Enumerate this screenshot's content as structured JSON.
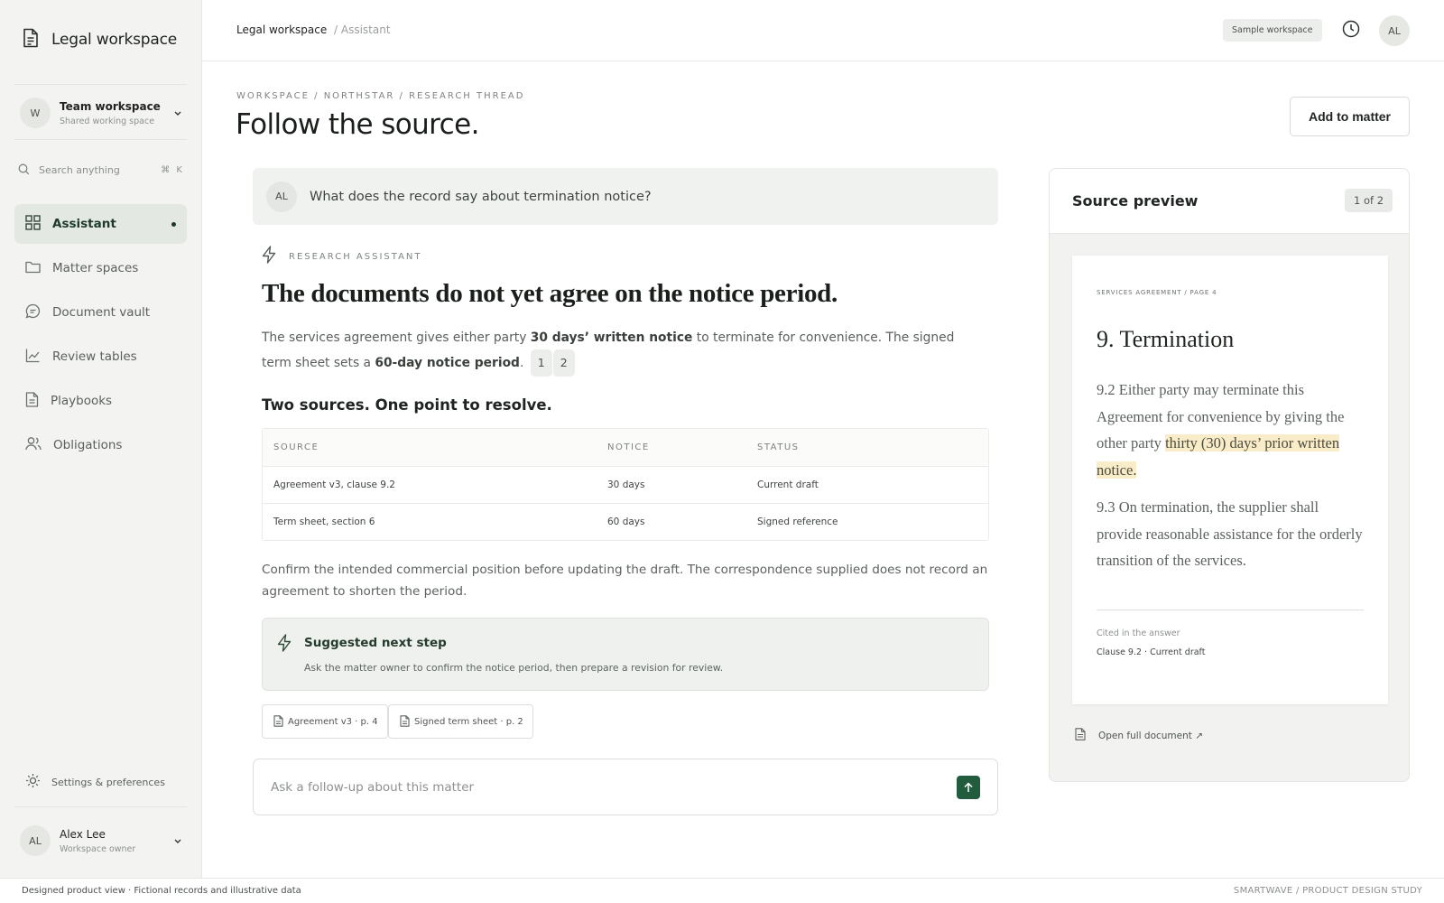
{
  "brand": {
    "name": "Legal workspace"
  },
  "workspace": {
    "initial": "W",
    "name": "Team workspace",
    "subtitle": "Shared working space"
  },
  "search": {
    "placeholder": "Search anything",
    "shortcut": "⌘ K"
  },
  "nav": {
    "items": [
      {
        "label": "Assistant",
        "icon": "grid-icon",
        "active": true
      },
      {
        "label": "Matter spaces",
        "icon": "folder-icon"
      },
      {
        "label": "Document vault",
        "icon": "chat-bubble-icon"
      },
      {
        "label": "Review tables",
        "icon": "line-chart-icon"
      },
      {
        "label": "Playbooks",
        "icon": "document-icon"
      },
      {
        "label": "Obligations",
        "icon": "users-icon"
      }
    ]
  },
  "settings": {
    "label": "Settings & preferences"
  },
  "user": {
    "initials": "AL",
    "name": "Alex Lee",
    "role": "Workspace owner"
  },
  "topbar": {
    "breadcrumb_main": "Legal workspace",
    "breadcrumb_sub": "/ Assistant",
    "badge": "Sample workspace",
    "avatar_initials": "AL"
  },
  "page": {
    "eyebrow": "WORKSPACE / NORTHSTAR / RESEARCH THREAD",
    "title": "Follow the source.",
    "add_button": "Add to matter"
  },
  "question": {
    "initials": "AL",
    "text": "What does the record say about termination notice?"
  },
  "answer": {
    "label": "RESEARCH ASSISTANT",
    "title": "The documents do not yet agree on the notice period.",
    "para_1": "The services agreement gives either party ",
    "para_bold_1": "30 days’ written notice",
    "para_2": " to terminate for convenience. The signed term sheet sets a ",
    "para_bold_2": "60-day notice period",
    "para_3": ".",
    "citations": [
      "1",
      "2"
    ],
    "section_title": "Two sources. One point to resolve.",
    "table": {
      "headers": [
        "SOURCE",
        "NOTICE",
        "STATUS"
      ],
      "rows": [
        [
          "Agreement v3, clause 9.2",
          "30 days",
          "Current draft"
        ],
        [
          "Term sheet, section 6",
          "60 days",
          "Signed reference"
        ]
      ]
    },
    "confirm_text": "Confirm the intended commercial position before updating the draft. The correspondence supplied does not record an agreement to shorten the period.",
    "suggest_title": "Suggested next step",
    "suggest_text": "Ask the matter owner to confirm the notice period, then prepare a revision for review.",
    "chips": [
      "Agreement v3 · p. 4",
      "Signed term sheet · p. 2"
    ]
  },
  "followup": {
    "placeholder": "Ask a follow-up about this matter"
  },
  "preview": {
    "title": "Source preview",
    "page_indicator": "1 of 2",
    "doc_eyebrow": "SERVICES AGREEMENT / PAGE 4",
    "doc_heading": "9. Termination",
    "clause_1_pre": "9.2   Either party may terminate this Agreement for convenience by giving the other party ",
    "clause_1_highlight": "thirty (30) days’ prior written notice.",
    "clause_2": "9.3   On termination, the supplier shall provide reasonable assistance for the orderly transition of the services.",
    "cited_label": "Cited in the answer",
    "cited_value": "Clause 9.2 · Current draft",
    "open_link": "Open full document ↗"
  },
  "footer": {
    "left": "Designed product view · Fictional records and illustrative data",
    "right": "SMARTWAVE / PRODUCT DESIGN STUDY"
  },
  "colors": {
    "accent": "#215c3e",
    "highlight": "#f8edc8",
    "sidebar_bg": "#f3f4f2"
  }
}
